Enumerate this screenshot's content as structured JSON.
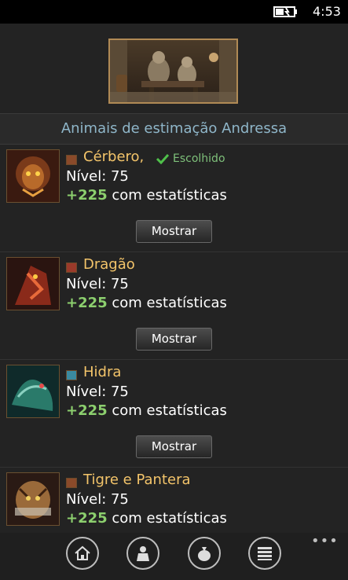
{
  "status_bar": {
    "time": "4:53",
    "battery_icon": "battery-charging-icon"
  },
  "section_title": "Animais de estimação Andressa",
  "pets": [
    {
      "name": "Cérbero,",
      "chosen_label": "Escolhido",
      "level": "Nível: 75",
      "bonus": "+225",
      "stats_suffix": "com estatísticas",
      "button": "Mostrar",
      "element_color": "#8a4a2a"
    },
    {
      "name": "Dragão",
      "chosen_label": "",
      "level": "Nível: 75",
      "bonus": "+225",
      "stats_suffix": "com estatísticas",
      "button": "Mostrar",
      "element_color": "#9a3a2a"
    },
    {
      "name": "Hidra",
      "chosen_label": "",
      "level": "Nível: 75",
      "bonus": "+225",
      "stats_suffix": "com estatísticas",
      "button": "Mostrar",
      "element_color": "#3a8aa0"
    },
    {
      "name": "Tigre e Pantera",
      "chosen_label": "",
      "level": "Nível: 75",
      "bonus": "+225",
      "stats_suffix": "com estatísticas",
      "button": "Mostrar",
      "element_color": "#8a4a2a"
    }
  ],
  "app_bar": {
    "icons": [
      "home-icon",
      "profile-icon",
      "bag-icon",
      "menu-list-icon"
    ],
    "more": "•••"
  },
  "colors": {
    "name": "#f3c46a",
    "bonus": "#8ccf6e",
    "header": "#8fb6c9",
    "chosen": "#7ec07a"
  }
}
